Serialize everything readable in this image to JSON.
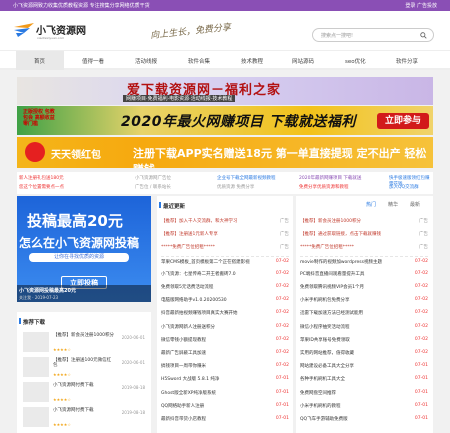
{
  "topbar": {
    "tagline": "小飞资源网致力收集优质教程资源 专注搜集分享网络优质干货",
    "links": "登录   广告投放"
  },
  "header": {
    "logo_text": "小飞资源网",
    "logo_sub": "xiaofeiziyuan.com",
    "slogan": "向上生长，免费分享",
    "search_placeholder": "搜索点一搜吧!"
  },
  "nav": {
    "items": [
      "首页",
      "值得一看",
      "活动线报",
      "软件合集",
      "技术教程",
      "网站源码",
      "seo优化",
      "软件分享"
    ],
    "active": 0
  },
  "banners": {
    "b1_title": "爱下载资源网－福利之家",
    "b1_sub": "网赚项目·免费福利·电影资源·活动线报·技术教程",
    "b2_left": "正版授权 包教包会 高额收益 零门槛",
    "b2_title": "2020年最火网赚项目 下载就送福利",
    "b2_cta": "立即参与",
    "b3_badge": "红",
    "b3_t1": "天天领红包",
    "b3_t2": "注册下载APP实名赠送18元 第一单直接提现 定不出产 轻松赚钱"
  },
  "links": [
    {
      "text": "新人注册礼包送180元",
      "color": "#e33"
    },
    {
      "text": "小飞资源网广告位",
      "color": "#999"
    },
    {
      "text": "企业号下载全网最新视频教程",
      "color": "#2a7ae2"
    },
    {
      "text": "2020年最新网赚项目 下载就送",
      "color": "#8a4fb5"
    },
    {
      "text": "快手极速版领红包赚零花钱",
      "color": "#2a7ae2"
    },
    {
      "text": "您这个位置需要点一点",
      "color": "#e33"
    },
    {
      "text": "广告位 / 联系站长",
      "color": "#999"
    },
    {
      "text": "优质资源 免费分享",
      "color": "#999"
    },
    {
      "text": "免费分享优质资源和教程",
      "color": "#e33"
    },
    {
      "text": "加入QQ交流群",
      "color": "#2a7ae2"
    }
  ],
  "slide": {
    "h1": "投稿最高20元",
    "h2": "怎么在小飞资源网投稿",
    "h3": "让你在寻找优质的资源",
    "btn": "立即投稿",
    "cap_title": "小飞资源网投稿最高20元",
    "cap_sub": "关注我 · 2019-07-23"
  },
  "left_panel": {
    "title": "推荐下载",
    "items": [
      {
        "name": "【推荐】新会员注册1000积分",
        "stars": "★★★★☆",
        "date": "2020-06-01"
      },
      {
        "name": "【推荐】注册送100元微信红包",
        "stars": "★★★★☆",
        "date": "2020-06-01"
      },
      {
        "name": "小飞资源网付费下载",
        "stars": "★★★★☆",
        "date": "2019-08-18"
      },
      {
        "name": "小飞资源网付费下载",
        "stars": "★★★★☆",
        "date": "2019-08-18"
      }
    ]
  },
  "mid": {
    "title": "最近更新",
    "rows": [
      {
        "text": "【推荐】加入千人交流群，和大神学习",
        "date": "广告",
        "pin": true
      },
      {
        "text": "【推荐】注册送1元新人专享",
        "date": "广告",
        "pin": true
      },
      {
        "text": "*****免费广告位招租*****",
        "date": "广告",
        "pin": true
      },
      {
        "text": "苹果CMS模板_首页模板第二个正在搭建影视",
        "date": "07-02"
      },
      {
        "text": "小飞资源：七星传奇二开王者搬砖7.0",
        "date": "07-02"
      },
      {
        "text": "免费领取5元话费活动流程",
        "date": "07-02"
      },
      {
        "text": "电脑版网络助手v1.0.20200530",
        "date": "07-02"
      },
      {
        "text": "抖音最新拍视频赚钱项目真实大赛开始",
        "date": "07-02"
      },
      {
        "text": "小飞资源网新人注册送积分",
        "date": "07-02"
      },
      {
        "text": "微信零钱小额提现教程",
        "date": "07-02"
      },
      {
        "text": "最新广告屏蔽工具加速",
        "date": "07-02"
      },
      {
        "text": "搞钱项目一周带你赚米",
        "date": "07-02"
      },
      {
        "text": "H5Sword 大战版 5.8.1 纯净",
        "date": "07-01"
      },
      {
        "text": "Ghost版全新XP纯净版系统",
        "date": "07-01"
      },
      {
        "text": "QQ网络助手新人注册",
        "date": "07-01"
      },
      {
        "text": "最新抖音带货小店教程",
        "date": "07-01"
      }
    ]
  },
  "right": {
    "tabs": [
      "热门",
      "精华",
      "最新"
    ],
    "rows": [
      {
        "text": "【推荐】新会员注册1000积分",
        "date": "广告",
        "pin": true
      },
      {
        "text": "【推荐】通过获取链接，点击下载就赚钱",
        "date": "广告",
        "pin": true
      },
      {
        "text": "*****免费广告位招租*****",
        "date": "广告",
        "pin": true
      },
      {
        "text": "movie制作的视频加wordpress视频主题",
        "date": "07-02"
      },
      {
        "text": "PC端抖音直播间观看量提升工具",
        "date": "07-02"
      },
      {
        "text": "免费领取腾讯视频VIP会员1个月",
        "date": "07-02"
      },
      {
        "text": "小米手机刷机包免费分享",
        "date": "07-02"
      },
      {
        "text": "迅雷下载加速方法已经测试能用",
        "date": "07-02"
      },
      {
        "text": "微信小程序抽奖活动流程",
        "date": "07-02"
      },
      {
        "text": "苹果ID共享账号免费领取",
        "date": "07-02"
      },
      {
        "text": "实用的网站推荐，值得收藏",
        "date": "07-02"
      },
      {
        "text": "网站建设必备工具大全分享",
        "date": "07-01"
      },
      {
        "text": "各种手机刷机工具大全",
        "date": "07-01"
      },
      {
        "text": "免费网盘空间推荐",
        "date": "07-01"
      },
      {
        "text": "小米手机刷机的教程",
        "date": "07-01"
      },
      {
        "text": "QQ飞车手游辅助免费版",
        "date": "07-01"
      }
    ]
  }
}
